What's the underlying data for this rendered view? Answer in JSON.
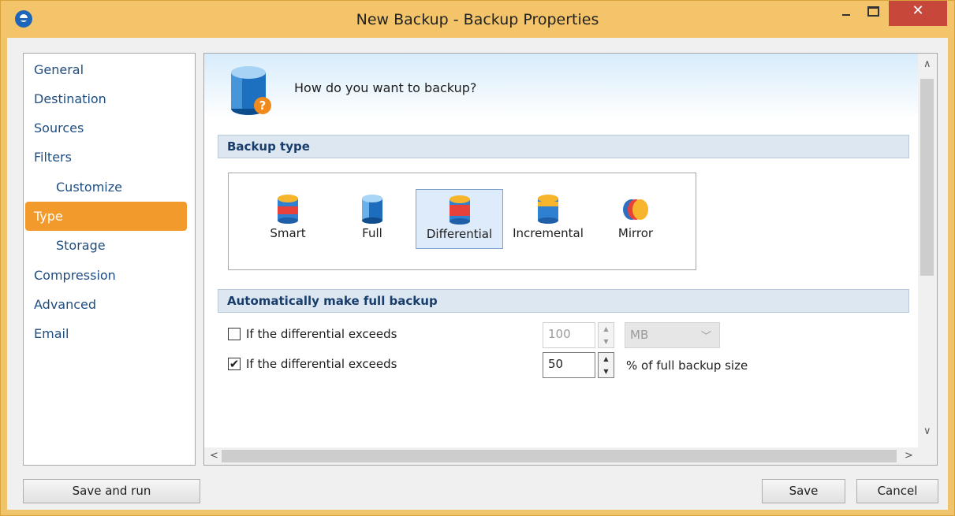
{
  "window": {
    "title": "New Backup - Backup Properties",
    "close_glyph": "✕"
  },
  "sidebar": {
    "items": [
      {
        "label": "General"
      },
      {
        "label": "Destination"
      },
      {
        "label": "Sources"
      },
      {
        "label": "Filters"
      },
      {
        "label": "Customize"
      },
      {
        "label": "Type"
      },
      {
        "label": "Storage"
      },
      {
        "label": "Compression"
      },
      {
        "label": "Advanced"
      },
      {
        "label": "Email"
      }
    ],
    "selected": "Type"
  },
  "main": {
    "header_text": "How do you want to backup?",
    "backup_type_section": "Backup type",
    "backup_types": [
      {
        "label": "Smart",
        "icon": "smart-backup-icon"
      },
      {
        "label": "Full",
        "icon": "full-backup-icon"
      },
      {
        "label": "Differential",
        "icon": "differential-backup-icon"
      },
      {
        "label": "Incremental",
        "icon": "incremental-backup-icon"
      },
      {
        "label": "Mirror",
        "icon": "mirror-backup-icon"
      }
    ],
    "selected_type": "Differential",
    "auto_full_section": "Automatically make full backup",
    "rule1": {
      "label": "If the differential exceeds",
      "checked": false,
      "value": "100",
      "unit": "MB"
    },
    "rule2": {
      "label": "If the differential exceeds",
      "checked": true,
      "value": "50",
      "suffix": "% of full backup size"
    }
  },
  "footer": {
    "save_and_run": "Save and run",
    "save": "Save",
    "cancel": "Cancel"
  },
  "colors": {
    "title_bar": "#f3c469",
    "close_button": "#c7483b",
    "nav_active": "#f39a2d",
    "nav_text": "#1d4d82",
    "section_bg": "#dce7f2"
  }
}
